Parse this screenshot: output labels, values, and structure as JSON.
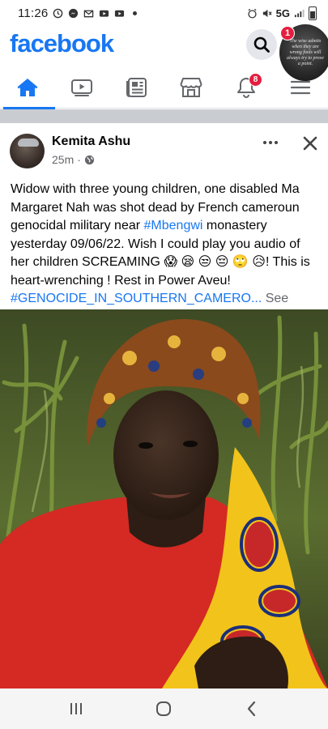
{
  "status_bar": {
    "time": "11:26",
    "network": "5G"
  },
  "header": {
    "logo": "facebook",
    "story_bubble_text": "The wise admits when they are wrong fools will always try to prove a point.",
    "story_badge": "1"
  },
  "nav_tabs": [
    {
      "name": "home",
      "icon": "home-icon",
      "active": true
    },
    {
      "name": "watch",
      "icon": "video-icon",
      "active": false
    },
    {
      "name": "news",
      "icon": "newsfeed-icon",
      "active": false
    },
    {
      "name": "marketplace",
      "icon": "marketplace-icon",
      "active": false
    },
    {
      "name": "notifications",
      "icon": "bell-icon",
      "active": false,
      "badge": "8"
    },
    {
      "name": "menu",
      "icon": "menu-icon",
      "active": false
    }
  ],
  "post": {
    "author": "Kemita Ashu",
    "time": "25m",
    "separator": "·",
    "text_1": "Widow with three young children, one disabled Ma Margaret Nah was shot dead by French cameroun genocidal military near ",
    "hashtag_1": "#Mbengwi",
    "text_2": " monastery yesterday 09/06/22. Wish I could play you audio of her children SCREAMING ",
    "emojis": "😱 😪 😒 😔 🙄 😥",
    "text_3": "! This is heart-wrenching ! Rest in Power Aveu! ",
    "hashtag_2": "#GENOCIDE_IN_SOUTHERN_CAMERO...",
    "see_more": "See more"
  },
  "colors": {
    "brand": "#1877f2",
    "badge": "#e41e3f",
    "secondary_text": "#65676b"
  }
}
